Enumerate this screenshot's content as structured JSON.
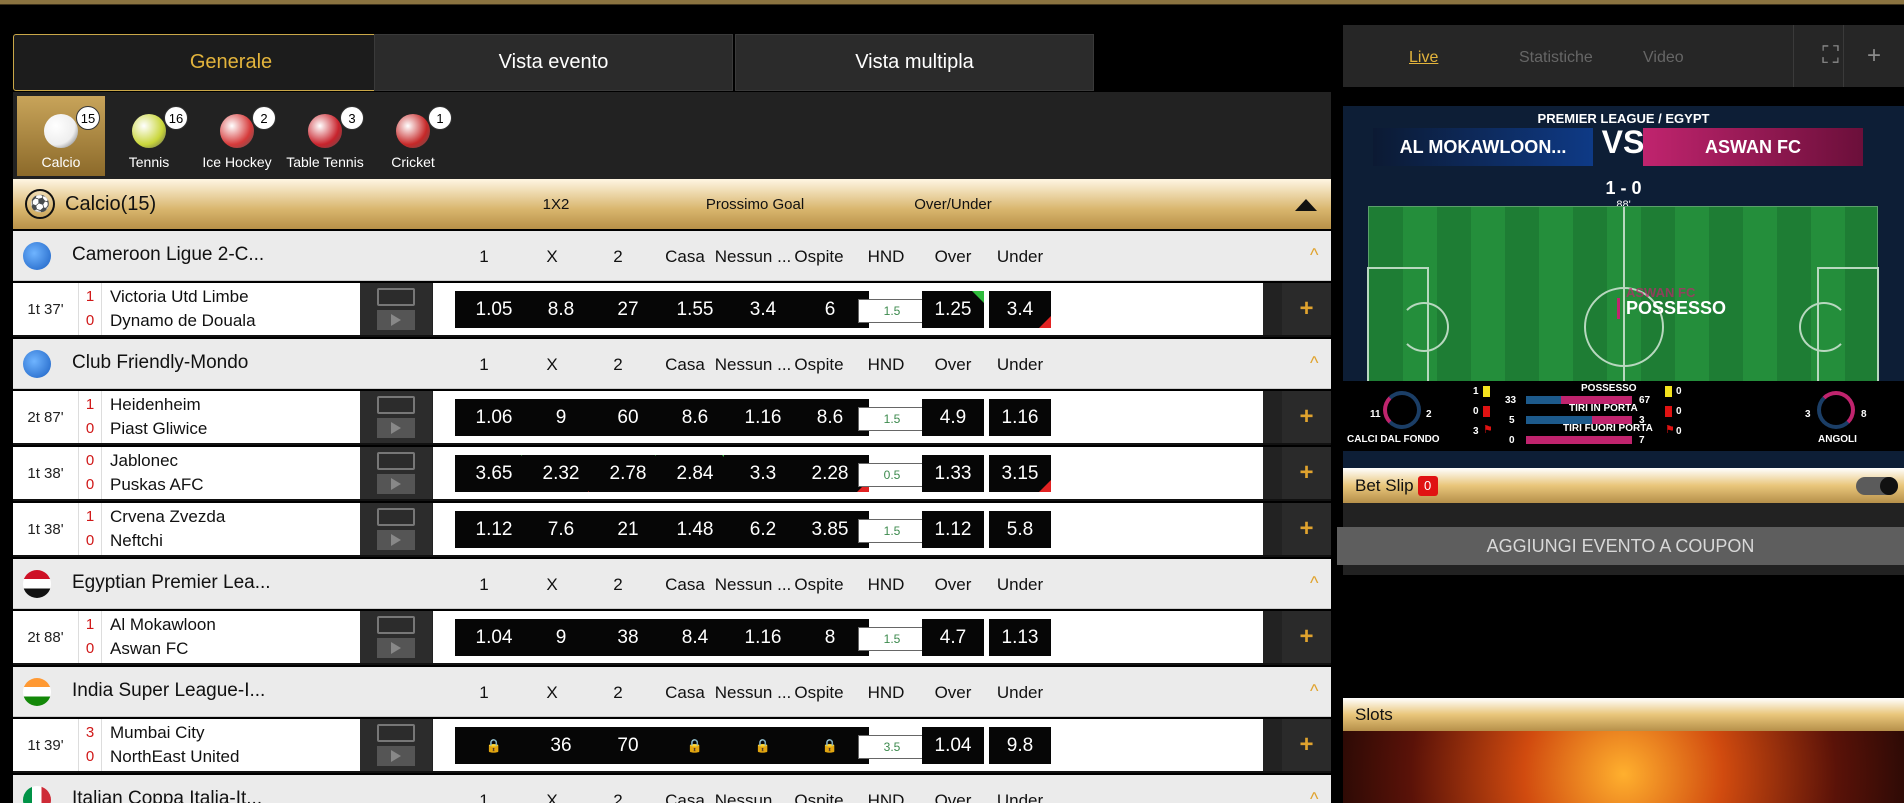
{
  "tabs": [
    "Generale",
    "Vista evento",
    "Vista multipla"
  ],
  "sports": [
    {
      "name": "Calcio",
      "count": "15",
      "icon": "soccer-ball-icon",
      "color": "#eeeeee"
    },
    {
      "name": "Tennis",
      "count": "16",
      "icon": "tennis-ball-icon",
      "color": "#c9d63a"
    },
    {
      "name": "Ice Hockey",
      "count": "2",
      "icon": "ice-hockey-icon",
      "color": "#d63a3a"
    },
    {
      "name": "Table Tennis",
      "count": "3",
      "icon": "table-tennis-icon",
      "color": "#c8232c"
    },
    {
      "name": "Cricket",
      "count": "1",
      "icon": "cricket-ball-icon",
      "color": "#c62828"
    }
  ],
  "section": {
    "title": "Calcio(15)",
    "cols": [
      "1X2",
      "Prossimo Goal",
      "Over/Under"
    ]
  },
  "market_headers": [
    "1",
    "X",
    "2",
    "Casa",
    "Nessun ...",
    "Ospite",
    "HND",
    "Over",
    "Under"
  ],
  "leagues": [
    {
      "name": "Cameroon Ligue 2-C...",
      "flag": "world",
      "matches": [
        {
          "time": "1t  37'",
          "s1": "1",
          "s2": "0",
          "home": "Victoria Utd Limbe",
          "away": "Dynamo de Douala",
          "odds": [
            "1.05",
            "8.8",
            "27",
            "1.55",
            "3.4",
            "6"
          ],
          "hnd": "1.5",
          "ou": [
            "1.25",
            "3.4"
          ],
          "marks": {
            "7": "up",
            "8": "dn"
          }
        }
      ]
    },
    {
      "name": "Club Friendly-Mondo",
      "flag": "world",
      "matches": [
        {
          "time": "2t  87'",
          "s1": "1",
          "s2": "0",
          "home": "Heidenheim",
          "away": "Piast Gliwice",
          "odds": [
            "1.06",
            "9",
            "60",
            "8.6",
            "1.16",
            "8.6"
          ],
          "hnd": "1.5",
          "ou": [
            "4.9",
            "1.16"
          ],
          "marks": {}
        },
        {
          "time": "1t  38'",
          "s1": "0",
          "s2": "0",
          "home": "Jablonec",
          "away": "Puskas AFC",
          "odds": [
            "3.65",
            "2.32",
            "2.78",
            "2.84",
            "3.3",
            "2.28"
          ],
          "hnd": "0.5",
          "ou": [
            "1.33",
            "3.15"
          ],
          "marks": {
            "0": "up",
            "1": "dn",
            "2": "up",
            "3": "up",
            "5": "dn",
            "8": "dn"
          }
        },
        {
          "time": "1t  38'",
          "s1": "1",
          "s2": "0",
          "home": "Crvena Zvezda",
          "away": "Neftchi",
          "odds": [
            "1.12",
            "7.6",
            "21",
            "1.48",
            "6.2",
            "3.85"
          ],
          "hnd": "1.5",
          "ou": [
            "1.12",
            "5.8"
          ],
          "marks": {}
        }
      ]
    },
    {
      "name": "Egyptian Premier Lea...",
      "flag": "egypt",
      "matches": [
        {
          "time": "2t  88'",
          "s1": "1",
          "s2": "0",
          "home": "Al Mokawloon",
          "away": "Aswan FC",
          "odds": [
            "1.04",
            "9",
            "38",
            "8.4",
            "1.16",
            "8"
          ],
          "hnd": "1.5",
          "ou": [
            "4.7",
            "1.13"
          ],
          "marks": {}
        }
      ]
    },
    {
      "name": "India Super League-I...",
      "flag": "india",
      "matches": [
        {
          "time": "1t  39'",
          "s1": "3",
          "s2": "0",
          "home": "Mumbai City",
          "away": "NorthEast United",
          "odds": [
            "LOCK",
            "36",
            "70",
            "LOCK",
            "LOCK",
            "LOCK"
          ],
          "hnd": "3.5",
          "ou": [
            "1.04",
            "9.8"
          ],
          "marks": {}
        }
      ]
    },
    {
      "name": "Italian Coppa Italia-It...",
      "flag": "italy",
      "matches": []
    }
  ],
  "right": {
    "tabs": [
      "Live",
      "Statistiche",
      "Video"
    ],
    "widget": {
      "league": "PREMIER LEAGUE / EGYPT",
      "home": "AL MOKAWLOON...",
      "away": "ASWAN FC",
      "vs": "VS",
      "score": "1 - 0",
      "minute": "88'",
      "poss_team": "ASWAN FC",
      "poss_label": "POSSESSO",
      "stats": {
        "possesso": {
          "label": "POSSESSO",
          "home": "33",
          "away": "67"
        },
        "tiri_porta": {
          "label": "TIRI IN PORTA",
          "home": "5",
          "away": "3"
        },
        "tiri_fuori": {
          "label": "TIRI FUORI PORTA",
          "home": "0",
          "away": "7"
        },
        "calci_fondo": {
          "label": "CALCI DAL FONDO",
          "home": "11",
          "away": "2"
        },
        "angoli": {
          "label": "ANGOLI",
          "home": "3",
          "away": "8"
        },
        "cards_home": [
          "1",
          "0",
          "3"
        ],
        "cards_away": [
          "0",
          "0",
          "0"
        ]
      }
    },
    "betslip": {
      "label": "Bet Slip",
      "count": "0",
      "button": "AGGIUNGI EVENTO A COUPON"
    },
    "slots": {
      "label": "Slots"
    }
  }
}
